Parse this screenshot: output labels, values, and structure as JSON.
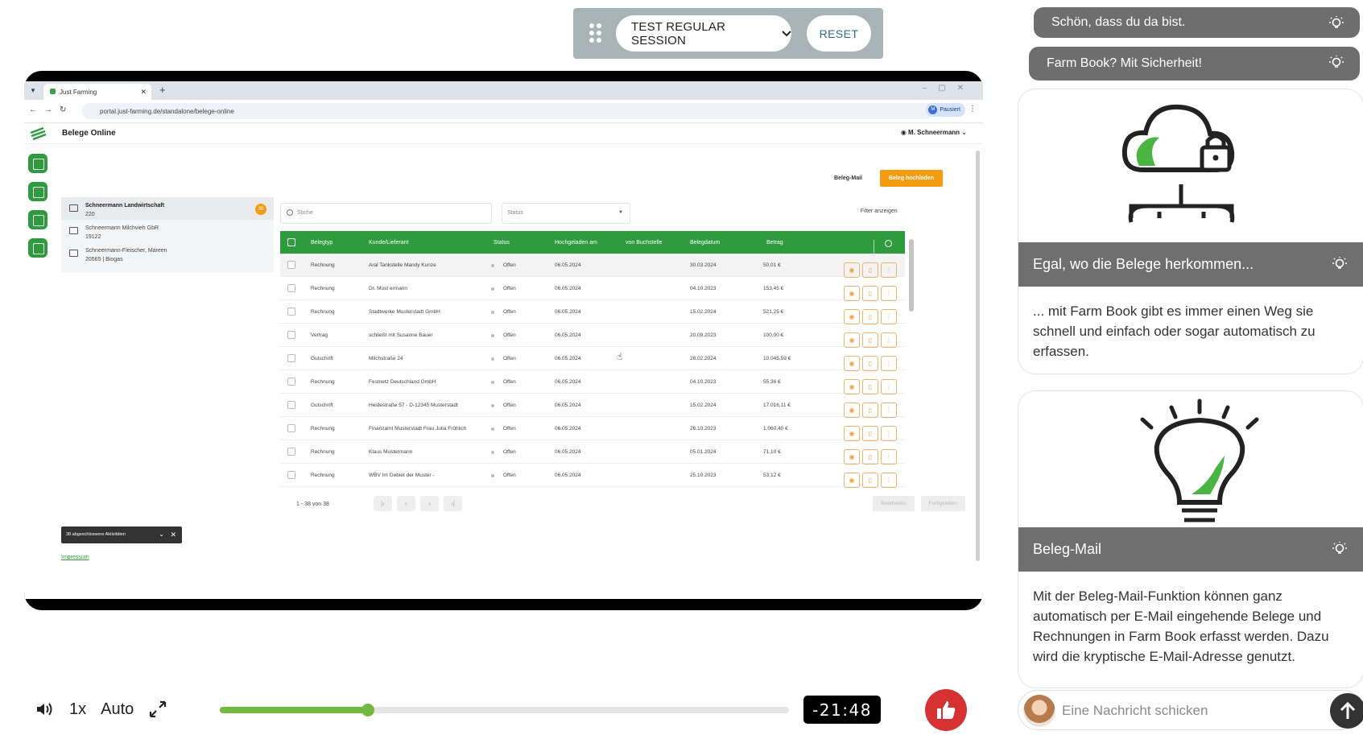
{
  "session": {
    "select_label": "TEST REGULAR SESSION",
    "reset_label": "RESET"
  },
  "browser": {
    "tab_title": "Just Farming",
    "url": "portal.just-farming.de/standalone/belege-online",
    "profile_initial": "M",
    "profile_label": "Pausiert"
  },
  "app": {
    "title": "Belege Online",
    "user": "M. Schneermann",
    "beleg_mail_link": "Beleg-Mail",
    "upload_button": "Beleg hochladen",
    "search_placeholder": "Suche",
    "status_placeholder": "Status",
    "filter_link": "Filter anzeigen",
    "organizations": [
      {
        "name": "Schneermann Landwirtschaft",
        "sub": "220",
        "badge": "38"
      },
      {
        "name": "Schneermann Milchvieh GbR",
        "sub": "19122"
      },
      {
        "name": "Schneermann-Fleischer, Mareen",
        "sub": "20565 | Biogas"
      }
    ],
    "columns": [
      "Belegtyp",
      "Kunde/Lieferant",
      "Status",
      "Hochgeladen am",
      "von Buchstelle",
      "Belegdatum",
      "Betrag"
    ],
    "rows": [
      {
        "typ": "Rechnung",
        "kunde": "Aral Tankstelle Mandy Kunze",
        "status": "Offen",
        "hochgeladen": "06.05.2024",
        "buchstelle": "",
        "datum": "30.03.2024",
        "betrag": "50,01 €"
      },
      {
        "typ": "Rechnung",
        "kunde": "Dr. Must ermann",
        "status": "Offen",
        "hochgeladen": "06.05.2024",
        "buchstelle": "",
        "datum": "04.10.2023",
        "betrag": "153,45 €"
      },
      {
        "typ": "Rechnung",
        "kunde": "Stadtwerke Musterstadt GmbH",
        "status": "Offen",
        "hochgeladen": "06.05.2024",
        "buchstelle": "",
        "datum": "15.02.2024",
        "betrag": "521,25 €"
      },
      {
        "typ": "Vertrag",
        "kunde": "schließt mit Susanne Bauer",
        "status": "Offen",
        "hochgeladen": "06.05.2024",
        "buchstelle": "",
        "datum": "20.09.2023",
        "betrag": "100,00 €"
      },
      {
        "typ": "Gutschrift",
        "kunde": "Milchstraße 24",
        "status": "Offen",
        "hochgeladen": "06.05.2024",
        "buchstelle": "",
        "datum": "28.02.2024",
        "betrag": "10.045,59 €"
      },
      {
        "typ": "Rechnung",
        "kunde": "Festnetz Deutschland GmbH",
        "status": "Offen",
        "hochgeladen": "06.05.2024",
        "buchstelle": "",
        "datum": "04.10.2023",
        "betrag": "55,36 €"
      },
      {
        "typ": "Gutschrift",
        "kunde": "Heidestraße 57 - D-12345 Musterstadt",
        "status": "Offen",
        "hochgeladen": "06.05.2024",
        "buchstelle": "",
        "datum": "15.02.2024",
        "betrag": "17.016,11 €"
      },
      {
        "typ": "Rechnung",
        "kunde": "Finanzamt Musterstadt Frau Julia Fröhlich",
        "status": "Offen",
        "hochgeladen": "06.05.2024",
        "buchstelle": "",
        "datum": "26.10.2023",
        "betrag": "1.060,40 €"
      },
      {
        "typ": "Rechnung",
        "kunde": "Klaus Mustermann",
        "status": "Offen",
        "hochgeladen": "06.05.2024",
        "buchstelle": "",
        "datum": "05.01.2024",
        "betrag": "71,10 €"
      },
      {
        "typ": "Rechnung",
        "kunde": "WBV Im Gebiet der Muster -",
        "status": "Offen",
        "hochgeladen": "06.05.2024",
        "buchstelle": "",
        "datum": "25.10.2023",
        "betrag": "53,12 €"
      }
    ],
    "pager_count": "1 - 38 von 38",
    "edit_button": "Bearbeiten",
    "finish_button": "Fertigstellen",
    "activity_label": "38 abgeschlossene Aktivitäten",
    "impressum": "Impressum"
  },
  "player": {
    "speed": "1x",
    "quality": "Auto",
    "time_remaining": "-21:48",
    "progress": 0.26,
    "accent": "#73b940"
  },
  "chat": {
    "messages": [
      {
        "title": "Schön, dass du da bist."
      },
      {
        "title": "Farm Book? Mit Sicherheit!"
      },
      {
        "title": "Egal, wo die Belege herkommen...",
        "text": "... mit Farm Book gibt es immer einen Weg sie schnell und einfach oder sogar automatisch zu erfassen."
      },
      {
        "title": "Beleg-Mail",
        "text": "Mit der Beleg-Mail-Funktion können ganz automatisch per E-Mail eingehende Belege und Rechnungen in Farm Book erfasst werden. Dazu wird die kryptische E-Mail-Adresse genutzt."
      }
    ],
    "input_placeholder": "Eine Nachricht schicken"
  }
}
